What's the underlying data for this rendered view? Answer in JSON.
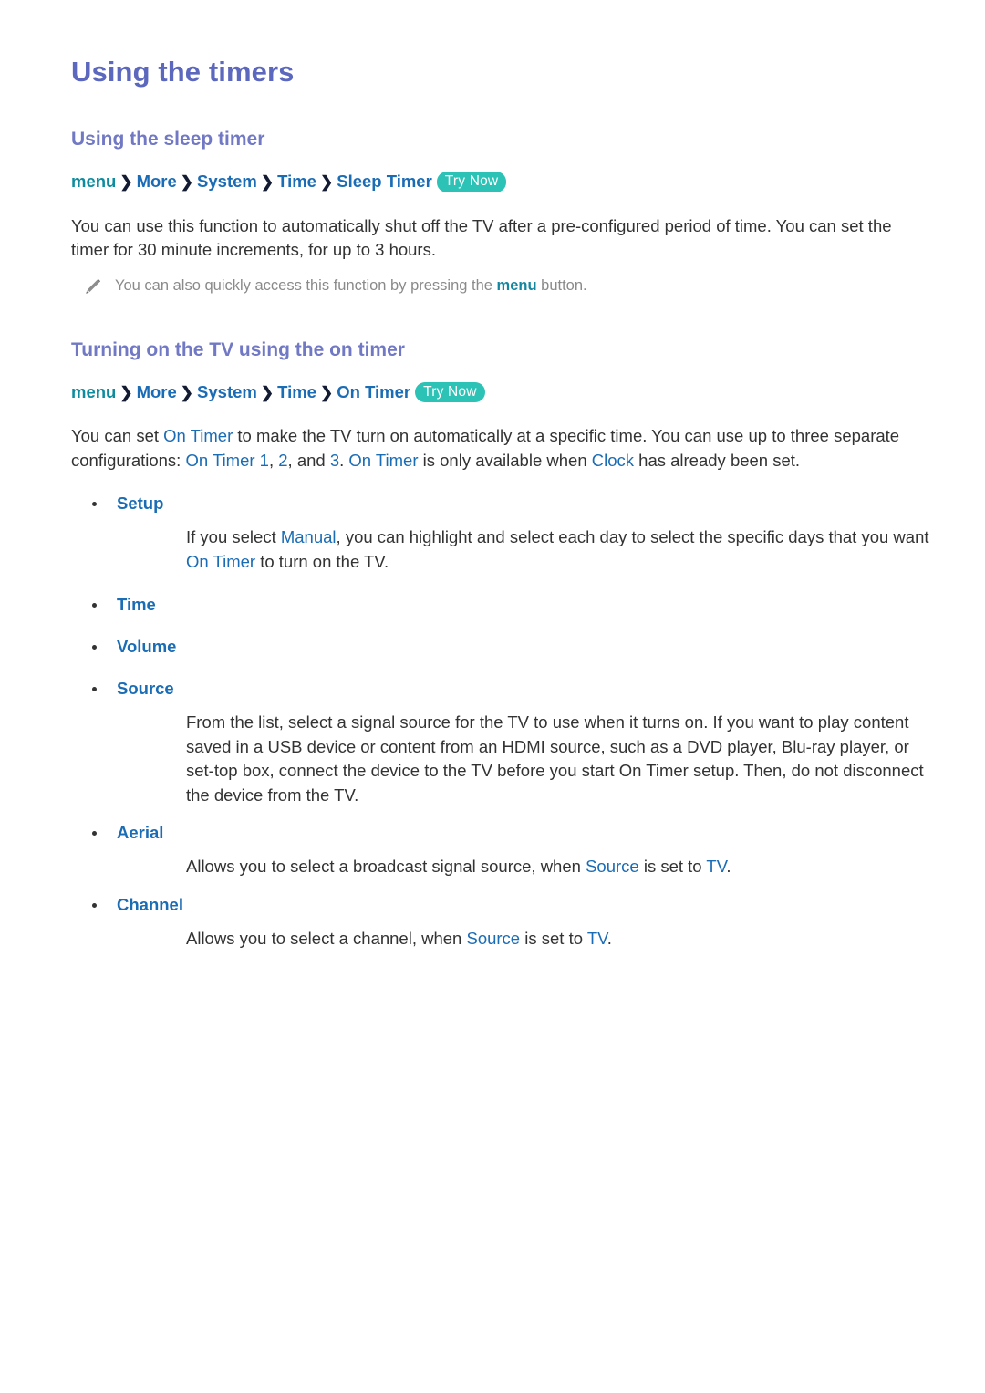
{
  "document": {
    "title": "Using the timers"
  },
  "colors": {
    "heading": "#5b68bd",
    "subheading": "#7178c4",
    "link_blue": "#1a6cb5",
    "link_teal": "#0c8c9e",
    "badge_bg": "#2cc2b6",
    "body_text": "#333333",
    "note_text": "#8a8a8a"
  },
  "sections": [
    {
      "heading": "Using the sleep timer",
      "breadcrumb": {
        "root": "menu",
        "separator": "❯",
        "items": [
          "More",
          "System",
          "Time",
          "Sleep Timer"
        ],
        "badge": "Try Now"
      },
      "paragraph": {
        "part1": "You can use this function to automatically shut off the TV after a pre-configured period of time. You can set the timer for 30 minute increments, for up to 3 hours."
      },
      "note": {
        "icon": "pencil-icon",
        "text_before": "You can also quickly access this function by pressing the ",
        "highlight": "menu",
        "text_after": " button."
      }
    },
    {
      "heading": "Turning on the TV using the on timer",
      "breadcrumb": {
        "root": "menu",
        "separator": "❯",
        "items": [
          "More",
          "System",
          "Time",
          "On Timer"
        ],
        "badge": "Try Now"
      },
      "intro": {
        "t1": "You can set ",
        "h1": "On Timer",
        "t2": " to make the TV turn on automatically at a specific time. You can use up to three separate configurations: ",
        "h2": "On Timer 1",
        "t3": ", ",
        "h3": "2",
        "t4": ", and ",
        "h4": "3",
        "t5": ". ",
        "h5": "On Timer",
        "t6": " is only available when ",
        "h6": "Clock",
        "t7": " has already been set."
      },
      "bullets": [
        {
          "label": "Setup",
          "body": {
            "t1": "If you select ",
            "h1": "Manual",
            "t2": ", you can highlight and select each day to select the specific days that you want ",
            "h2": "On Timer",
            "t3": " to turn on the TV."
          }
        },
        {
          "label": "Time",
          "body": null
        },
        {
          "label": "Volume",
          "body": null
        },
        {
          "label": "Source",
          "body": {
            "t1": "From the list, select a signal source for the TV to use when it turns on. If you want to play content saved in a USB device or content from an HDMI source, such as a DVD player, Blu-ray player, or set-top box, connect the device to the TV before you start On Timer setup. Then, do not disconnect the device from the TV."
          }
        },
        {
          "label": "Aerial",
          "body": {
            "t1": "Allows you to select a broadcast signal source, when ",
            "h1": "Source",
            "t2": " is set to ",
            "h2": "TV",
            "t3": "."
          }
        },
        {
          "label": "Channel",
          "body": {
            "t1": "Allows you to select a channel, when ",
            "h1": "Source",
            "t2": " is set to ",
            "h2": "TV",
            "t3": "."
          }
        }
      ]
    }
  ]
}
